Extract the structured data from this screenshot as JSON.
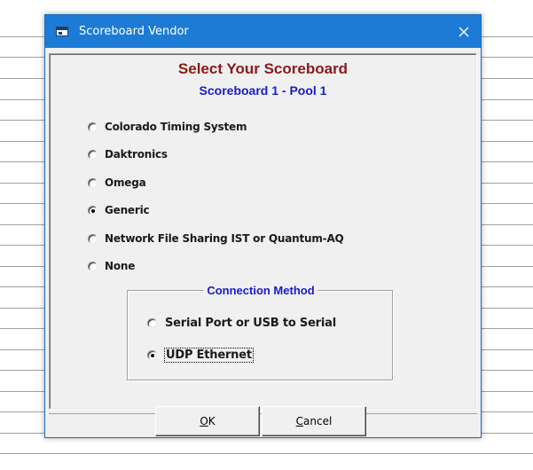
{
  "window": {
    "title": "Scoreboard Vendor",
    "accent_color": "#1d7bd6"
  },
  "heading": "Select Your Scoreboard",
  "subheading": "Scoreboard 1 - Pool 1",
  "vendors": [
    {
      "label": "Colorado Timing System",
      "checked": false
    },
    {
      "label": "Daktronics",
      "checked": false
    },
    {
      "label": "Omega",
      "checked": false
    },
    {
      "label": "Generic",
      "checked": true
    },
    {
      "label": "Network File Sharing IST or Quantum-AQ",
      "checked": false
    },
    {
      "label": "None",
      "checked": false
    }
  ],
  "connection": {
    "legend": "Connection Method",
    "options": [
      {
        "label": "Serial Port or USB to Serial",
        "checked": false
      },
      {
        "label": "UDP Ethernet",
        "checked": true
      }
    ]
  },
  "buttons": {
    "ok": {
      "mnemonic": "O",
      "rest": "K"
    },
    "cancel": {
      "mnemonic": "C",
      "rest": "ancel"
    }
  },
  "icons": {
    "app": "app-window-icon",
    "close": "close-icon"
  }
}
